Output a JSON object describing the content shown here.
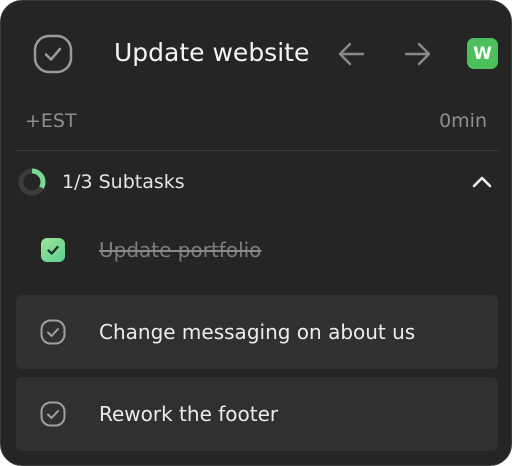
{
  "task": {
    "title": "Update website",
    "badge_letter": "W",
    "badge_color": "#4cc05a",
    "complete_icon": "check-circle-icon",
    "back_icon": "arrow-left-icon",
    "forward_icon": "arrow-right-icon"
  },
  "estimate": {
    "label": "+EST",
    "value": "0min"
  },
  "subtasks": {
    "summary": "1/3 Subtasks",
    "completed": 1,
    "total": 3,
    "progress_fraction": 0.333,
    "progress_color": "#7bd88f",
    "collapse_icon": "chevron-up-icon",
    "items": [
      {
        "label": "Update portfolio",
        "done": true
      },
      {
        "label": "Change messaging on about us",
        "done": false
      },
      {
        "label": "Rework the footer",
        "done": false
      }
    ]
  }
}
